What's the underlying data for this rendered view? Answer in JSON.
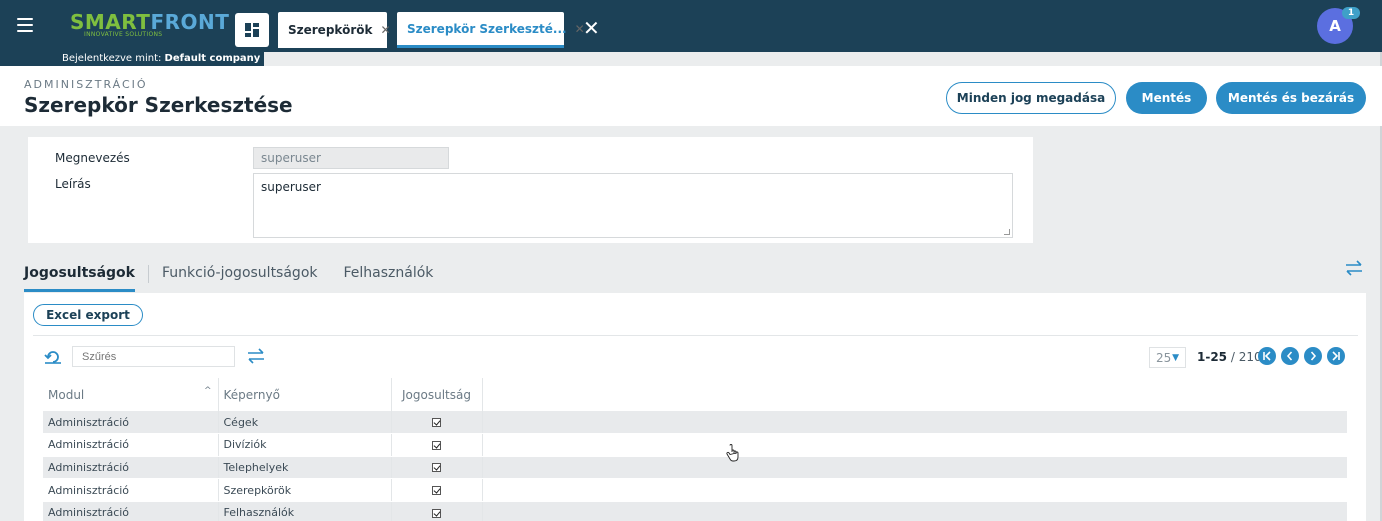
{
  "app": {
    "logo_part1": "SMART",
    "logo_part2": "FRONT",
    "logo_tagline": "INNOVATIVE SOLUTIONS",
    "tabs": [
      {
        "label": "Szerepkörök"
      },
      {
        "label": "Szerepkör Szerkeszté..."
      }
    ],
    "avatar_letter": "A",
    "notification_count": "1",
    "logged_in_prefix": "Bejelentkezve mint: ",
    "company": "Default company"
  },
  "header": {
    "breadcrumb": "ADMINISZTRÁCIÓ",
    "title": "Szerepkör Szerkesztése",
    "grant_all_label": "Minden jog megadása",
    "save_label": "Mentés",
    "save_close_label": "Mentés és bezárás"
  },
  "form": {
    "name_label": "Megnevezés",
    "name_value": "superuser",
    "description_label": "Leírás",
    "description_value": "superuser"
  },
  "section_tabs": [
    {
      "label": "Jogosultságok",
      "active": true
    },
    {
      "label": "Funkció-jogosultságok",
      "active": false
    },
    {
      "label": "Felhasználók",
      "active": false
    }
  ],
  "grid": {
    "excel_label": "Excel export",
    "filter_placeholder": "Szűrés",
    "page_size": "25",
    "range": "1-25",
    "total": "/ 210",
    "columns": [
      "Modul",
      "Képernyő",
      "Jogosultság"
    ],
    "rows": [
      {
        "modul": "Adminisztráció",
        "screen": "Cégek",
        "checked": true
      },
      {
        "modul": "Adminisztráció",
        "screen": "Divíziók",
        "checked": true
      },
      {
        "modul": "Adminisztráció",
        "screen": "Telephelyek",
        "checked": true
      },
      {
        "modul": "Adminisztráció",
        "screen": "Szerepkörök",
        "checked": true
      },
      {
        "modul": "Adminisztráció",
        "screen": "Felhasználók",
        "checked": true
      }
    ]
  },
  "colors": {
    "topbar": "#1c4157",
    "accent": "#2b8cc6",
    "avatar": "#5b6fe0",
    "logo_green": "#7fbf3f"
  }
}
